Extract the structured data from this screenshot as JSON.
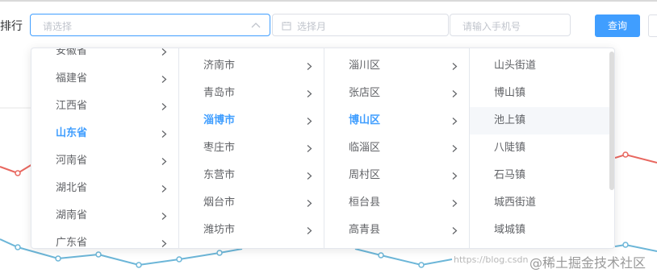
{
  "filters": {
    "rank_label": "排行",
    "cascader_placeholder": "请选择",
    "month_placeholder": "选择月",
    "phone_placeholder": "请输入手机号",
    "query_label": "查询"
  },
  "cascader": {
    "provinces": [
      {
        "label": "安徽省",
        "active": false
      },
      {
        "label": "福建省",
        "active": false
      },
      {
        "label": "江西省",
        "active": false
      },
      {
        "label": "山东省",
        "active": true
      },
      {
        "label": "河南省",
        "active": false
      },
      {
        "label": "湖北省",
        "active": false
      },
      {
        "label": "湖南省",
        "active": false
      },
      {
        "label": "广东省",
        "active": false
      }
    ],
    "cities": [
      {
        "label": "济南市",
        "active": false
      },
      {
        "label": "青岛市",
        "active": false
      },
      {
        "label": "淄博市",
        "active": true
      },
      {
        "label": "枣庄市",
        "active": false
      },
      {
        "label": "东营市",
        "active": false
      },
      {
        "label": "烟台市",
        "active": false
      },
      {
        "label": "潍坊市",
        "active": false
      }
    ],
    "districts": [
      {
        "label": "淄川区",
        "active": false
      },
      {
        "label": "张店区",
        "active": false
      },
      {
        "label": "博山区",
        "active": true
      },
      {
        "label": "临淄区",
        "active": false
      },
      {
        "label": "周村区",
        "active": false
      },
      {
        "label": "桓台县",
        "active": false
      },
      {
        "label": "高青县",
        "active": false
      }
    ],
    "towns": [
      {
        "label": "山头街道",
        "hover": false
      },
      {
        "label": "博山镇",
        "hover": false
      },
      {
        "label": "池上镇",
        "hover": true
      },
      {
        "label": "八陡镇",
        "hover": false
      },
      {
        "label": "石马镇",
        "hover": false
      },
      {
        "label": "城西街道",
        "hover": false
      },
      {
        "label": "域城镇",
        "hover": false
      }
    ]
  },
  "watermark": {
    "url": "https://blog.csdn",
    "brand": "@稀土掘金技术社区"
  },
  "colors": {
    "accent": "#409eff",
    "red_series": "#e8675f",
    "blue_series": "#6cb6d8"
  }
}
